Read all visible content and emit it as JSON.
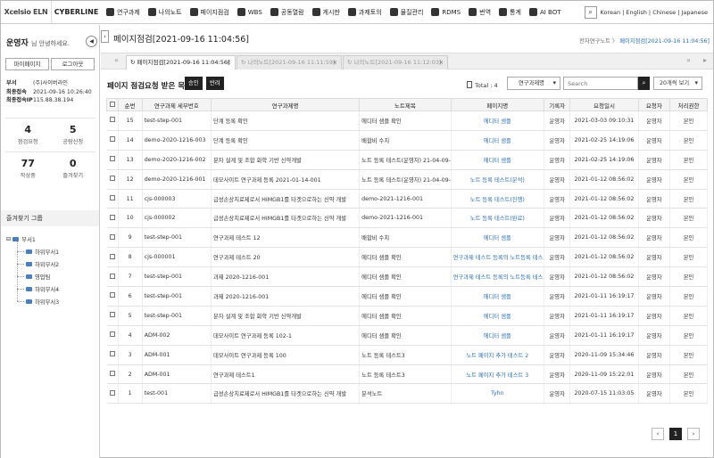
{
  "header": {
    "logo": "Xcelsio ELN",
    "brand": "CYBERLINE",
    "menu": [
      {
        "label": "연구과제",
        "icon": "flask-icon"
      },
      {
        "label": "나의노트",
        "icon": "notebook-icon"
      },
      {
        "label": "페이지점검",
        "icon": "page-check-icon"
      },
      {
        "label": "WBS",
        "icon": "wbs-icon"
      },
      {
        "label": "공동열람",
        "icon": "share-icon"
      },
      {
        "label": "게시판",
        "icon": "board-icon"
      },
      {
        "label": "과제토의",
        "icon": "chat-icon"
      },
      {
        "label": "물질관리",
        "icon": "substance-icon"
      },
      {
        "label": "RDMS",
        "icon": "rdms-icon"
      },
      {
        "label": "번역",
        "icon": "translate-icon"
      },
      {
        "label": "통계",
        "icon": "stats-icon"
      },
      {
        "label": "AI BOT",
        "icon": "bot-icon"
      }
    ],
    "languages": "Korean | English | Chinese | Japanese"
  },
  "sidebar": {
    "user_name": "운영자",
    "greeting": "님 안녕하세요.",
    "mypage": "마이페이지",
    "logout": "로그아웃",
    "info": [
      {
        "k": "부서",
        "v": "(주)사이버라인"
      },
      {
        "k": "최종접속",
        "v": "2021-09-16 10:26:40"
      },
      {
        "k": "최종접속IP",
        "v": "115.88.38.194"
      }
    ],
    "stats": [
      {
        "n": "4",
        "l": "점검요청"
      },
      {
        "n": "5",
        "l": "공람신청"
      },
      {
        "n": "77",
        "l": "작성중"
      },
      {
        "n": "0",
        "l": "즐겨찾기"
      }
    ],
    "fav_title": "즐겨찾기 그룹",
    "tree_root": "부서1",
    "tree_children": [
      "하위부서1",
      "하위부서2",
      "영업팀",
      "하위부서4",
      "하위부서3"
    ]
  },
  "main": {
    "title": "페이지점검[2021-09-16 11:04:56]",
    "breadcrumb_parent": "전자연구노트",
    "breadcrumb_sep": "〉",
    "breadcrumb_current": "페이지점검[2021-09-16 11:04:56]",
    "tabs": [
      {
        "label": "페이지점검[2021-09-16 11:04:56]",
        "close": "×"
      },
      {
        "label": "나의노트[2021-09-16 11:11:59]",
        "close": "×"
      },
      {
        "label": "나의노트[2021-09-16 11:12:03]",
        "close": "×"
      }
    ],
    "list_title": "페이지 점검요청 받은 목록",
    "approve": "승인",
    "reject": "반려",
    "total": "Total : 4",
    "filter_select": "연구과제명",
    "search_placeholder": "Search",
    "page_size": "20개씩 보기",
    "columns": [
      "순번",
      "연구과제 세부번호",
      "연구과제명",
      "노트제목",
      "페이지명",
      "기록자",
      "요청일시",
      "요청자",
      "처리권한"
    ],
    "rows": [
      [
        "15",
        "test-step-001",
        "단계 등록 확인",
        "에디터 샘플 확인",
        "에디터 샘플",
        "운영자",
        "2021-03-03 09:10:31",
        "운영자",
        "본인"
      ],
      [
        "14",
        "demo-2020-1216-003",
        "단계 등록 확인",
        "배합비 수치",
        "에디터 샘플",
        "운영자",
        "2021-02-25 14:19:06",
        "운영자",
        "본인"
      ],
      [
        "13",
        "demo-2020-1216-002",
        "분자 설계 및 조합 화학 기반 신약개발",
        "노트 등록 테스트(운영자) 21-04-09-002",
        "에디터 샘플",
        "운영자",
        "2021-02-25 14:19:06",
        "운영자",
        "본인"
      ],
      [
        "12",
        "demo-2020-1216-001",
        "데모사이트 연구과제 등록 2021-01-14-001",
        "노트 등록 테스트(운영자) 21-04-09-001",
        "노트 등록 테스트(분석)",
        "운영자",
        "2021-01-12 08:56:02",
        "운영자",
        "본인"
      ],
      [
        "11",
        "cjs-000003",
        "급성손상치료제로서 HIMGB1를 타겟으로하는 신약 개발",
        "demo-2021-1216-001",
        "노트 등록 테스트(진행)",
        "운영자",
        "2021-01-12 08:56:02",
        "운영자",
        "본인"
      ],
      [
        "10",
        "cjs-000002",
        "급성손상치료제로서 HIMGB1를 타겟으로하는 신약 개발",
        "demo-2021-1216-001",
        "노트 등록 테스트(완료)",
        "운영자",
        "2021-01-12 08:56:02",
        "운영자",
        "본인"
      ],
      [
        "9",
        "test-step-001",
        "연구과제 테스트 12",
        "배합비 수치",
        "에디터 샘플",
        "운영자",
        "2021-01-12 08:56:02",
        "운영자",
        "본인"
      ],
      [
        "8",
        "cjs-000001",
        "연구과제 테스트 20",
        "에디터 샘플 확인",
        "연구과제 테스트 등록의 노트등록 테스트",
        "운영자",
        "2021-01-12 08:56:02",
        "운영자",
        "본인"
      ],
      [
        "7",
        "test-step-001",
        "과제 2020-1216-001",
        "에디터 샘플 확인",
        "연구과제 테스트 등록의 노트등록 테스트",
        "운영자",
        "2021-01-12 08:56:02",
        "운영자",
        "본인"
      ],
      [
        "6",
        "test-step-001",
        "과제 2020-1216-001",
        "에디터 샘플 확인",
        "에디터 샘플",
        "운영자",
        "2021-01-11 16:19:17",
        "운영자",
        "본인"
      ],
      [
        "5",
        "test-step-001",
        "분자 설계 및 조합 화학 기반 신약개발",
        "에디터 샘플 확인",
        "에디터 샘플",
        "운영자",
        "2021-01-11 16:19:17",
        "운영자",
        "본인"
      ],
      [
        "4",
        "ADM-002",
        "데모사이트 연구과제 등록 102-1",
        "에디터 샘플 확인",
        "에디터 샘플",
        "운영자",
        "2021-01-11 16:19:17",
        "운영자",
        "본인"
      ],
      [
        "3",
        "ADM-001",
        "데모사이트 연구과제 등록 100",
        "노트 등록 테스트3",
        "노트 페이지 추가 테스트 2",
        "운영자",
        "2020-11-09 15:34:46",
        "운영자",
        "본인"
      ],
      [
        "2",
        "ADM-001",
        "연구과제 테스트1",
        "노트 등록 테스트3",
        "노트 페이지 추가 테스트 3",
        "운영자",
        "2020-11-09 15:22:01",
        "운영자",
        "본인"
      ],
      [
        "1",
        "test-001",
        "급성손상치료제로서 HIMGB1를 타겟으로하는 신약 개발",
        "분석노트",
        "Tyhn",
        "운영자",
        "2020-07-15 11:03:05",
        "운영자",
        "본인"
      ]
    ],
    "pager_prev": "‹",
    "pager_current": "1",
    "pager_next": "›"
  }
}
